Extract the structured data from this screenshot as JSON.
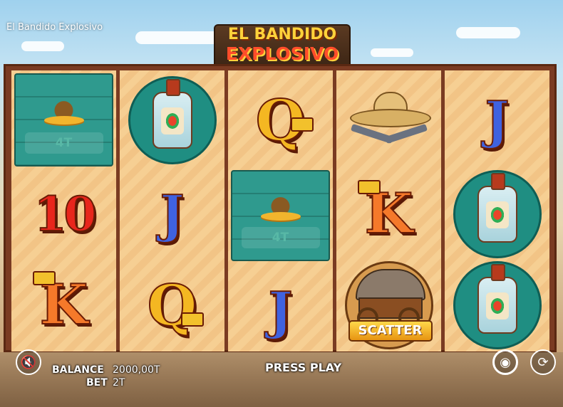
{
  "window": {
    "title": "El Bandido Explosivo"
  },
  "logo": {
    "line1": "EL BANDIDO",
    "line2": "EXPLOSIVO"
  },
  "reels": [
    [
      {
        "type": "money",
        "value": "4T"
      },
      {
        "type": "ten",
        "label": "10"
      },
      {
        "type": "king",
        "label": "K"
      }
    ],
    [
      {
        "type": "bottle"
      },
      {
        "type": "jack",
        "label": "J"
      },
      {
        "type": "queen",
        "label": "Q"
      }
    ],
    [
      {
        "type": "queen",
        "label": "Q"
      },
      {
        "type": "money",
        "value": "4T"
      },
      {
        "type": "jack",
        "label": "J"
      }
    ],
    [
      {
        "type": "sombrero"
      },
      {
        "type": "king",
        "label": "K"
      },
      {
        "type": "scatter",
        "label": "SCATTER"
      }
    ],
    [
      {
        "type": "jack",
        "label": "J"
      },
      {
        "type": "bottle"
      },
      {
        "type": "bottle"
      }
    ]
  ],
  "hud": {
    "balance_label": "BALANCE",
    "balance_value": "2000,00T",
    "bet_label": "BET",
    "bet_value": "2T",
    "press_play": "PRESS PLAY",
    "sound_icon": "speaker-muted-icon",
    "settings_icon": "chip-icon",
    "autoplay_icon": "spin-arrows-icon"
  },
  "colors": {
    "teal_wood": "#2f9a8e",
    "reel_frame": "#7a3b22",
    "sky": "#9fd1ee"
  }
}
